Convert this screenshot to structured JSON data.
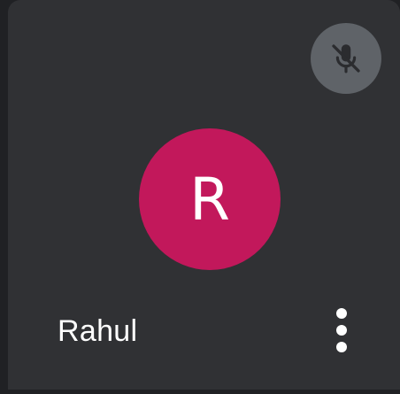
{
  "participant": {
    "name": "Rahul",
    "initial": "R",
    "avatar_color": "#c2185b",
    "muted": true
  },
  "icons": {
    "mute": "mic-off-icon",
    "menu": "more-vert-icon"
  },
  "colors": {
    "tile_background": "#303134",
    "page_background": "#202124",
    "mute_badge": "#5f6368"
  }
}
